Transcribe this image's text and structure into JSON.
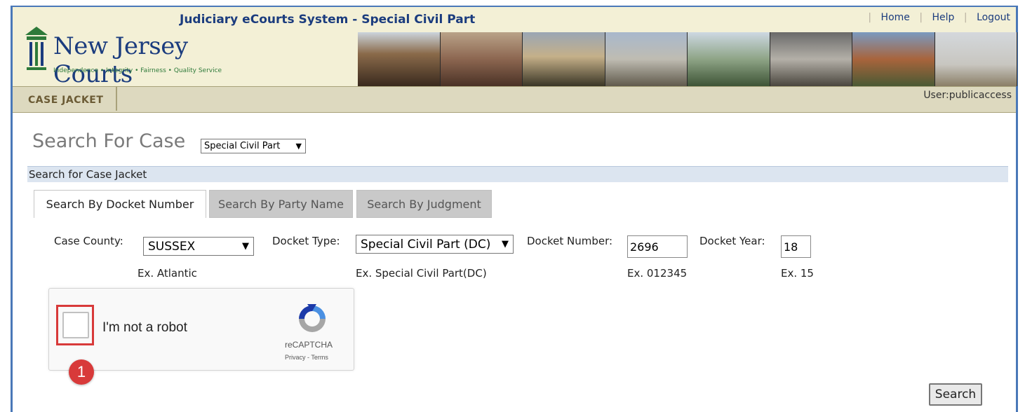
{
  "header": {
    "app_title": "Judiciary eCourts System - Special Civil Part",
    "links": [
      "Home",
      "Help",
      "Logout"
    ],
    "logo_name": "New Jersey Courts",
    "logo_tagline": "Independence • Integrity • Fairness • Quality Service"
  },
  "nav": {
    "tab_label": "CASE JACKET",
    "user_label": "User:publicaccess"
  },
  "page": {
    "title": "Search For Case",
    "court_type": "Special Civil Part",
    "section_title": "Search for Case Jacket"
  },
  "tabs": [
    {
      "label": "Search By Docket Number",
      "active": true
    },
    {
      "label": "Search By Party Name",
      "active": false
    },
    {
      "label": "Search By Judgment",
      "active": false
    }
  ],
  "form": {
    "county": {
      "label": "Case County:",
      "value": "SUSSEX",
      "hint": "Ex. Atlantic"
    },
    "docket_type": {
      "label": "Docket Type:",
      "value": "Special Civil Part (DC)",
      "hint": "Ex. Special Civil Part(DC)"
    },
    "docket_number": {
      "label": "Docket Number:",
      "value": "2696",
      "hint": "Ex. 012345"
    },
    "docket_year": {
      "label": "Docket Year:",
      "value": "18",
      "hint": "Ex. 15"
    }
  },
  "captcha": {
    "label": "I'm not a robot",
    "brand": "reCAPTCHA",
    "links": "Privacy - Terms"
  },
  "annotation_badge": "1",
  "search_button": "Search",
  "colors": {
    "title_blue": "#1b3c7e",
    "header_bg": "#f3f0d6",
    "highlight_red": "#d83a3a"
  }
}
